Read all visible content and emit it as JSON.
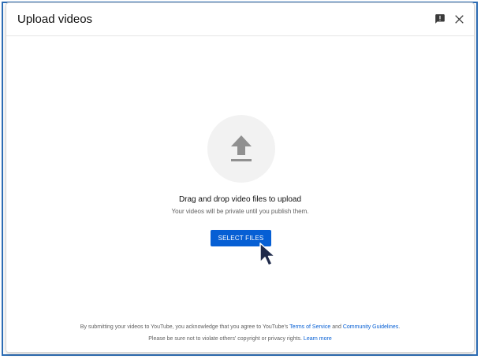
{
  "dialog": {
    "title": "Upload videos",
    "header_icons": {
      "feedback": "feedback-icon",
      "close": "close-icon"
    }
  },
  "upload": {
    "icon": "upload-arrow-icon",
    "drag_text": "Drag and drop video files to upload",
    "private_text": "Your videos will be private until you publish them.",
    "select_button": "SELECT FILES"
  },
  "legal": {
    "line1_prefix": "By submitting your videos to YouTube, you acknowledge that you agree to YouTube's ",
    "terms_link": "Terms of Service",
    "and": " and ",
    "guidelines_link": "Community Guidelines",
    "line1_suffix": ".",
    "line2_prefix": "Please be sure not to violate others' copyright or privacy rights. ",
    "learn_more_link": "Learn more"
  },
  "colors": {
    "accent": "#065fd4",
    "circle_bg": "#f2f2f2",
    "icon_gray": "#909090",
    "frame_border": "#2d6db5"
  }
}
